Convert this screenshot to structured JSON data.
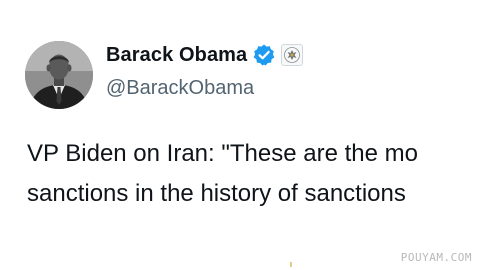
{
  "tweet": {
    "author": {
      "display_name": "Barack Obama",
      "handle": "@BarackObama",
      "avatar_icon": "profile-photo",
      "verified_icon": "verified-badge-icon",
      "affiliation_icon": "government-seal-icon"
    },
    "text_lines": [
      "VP Biden on Iran: \"These are the mo",
      "sanctions in the history of sanctions"
    ]
  },
  "watermark": "POUYAM.COM",
  "colors": {
    "name": "#0f1419",
    "handle": "#536471",
    "verified": "#1d9bf0",
    "background": "#ffffff"
  }
}
